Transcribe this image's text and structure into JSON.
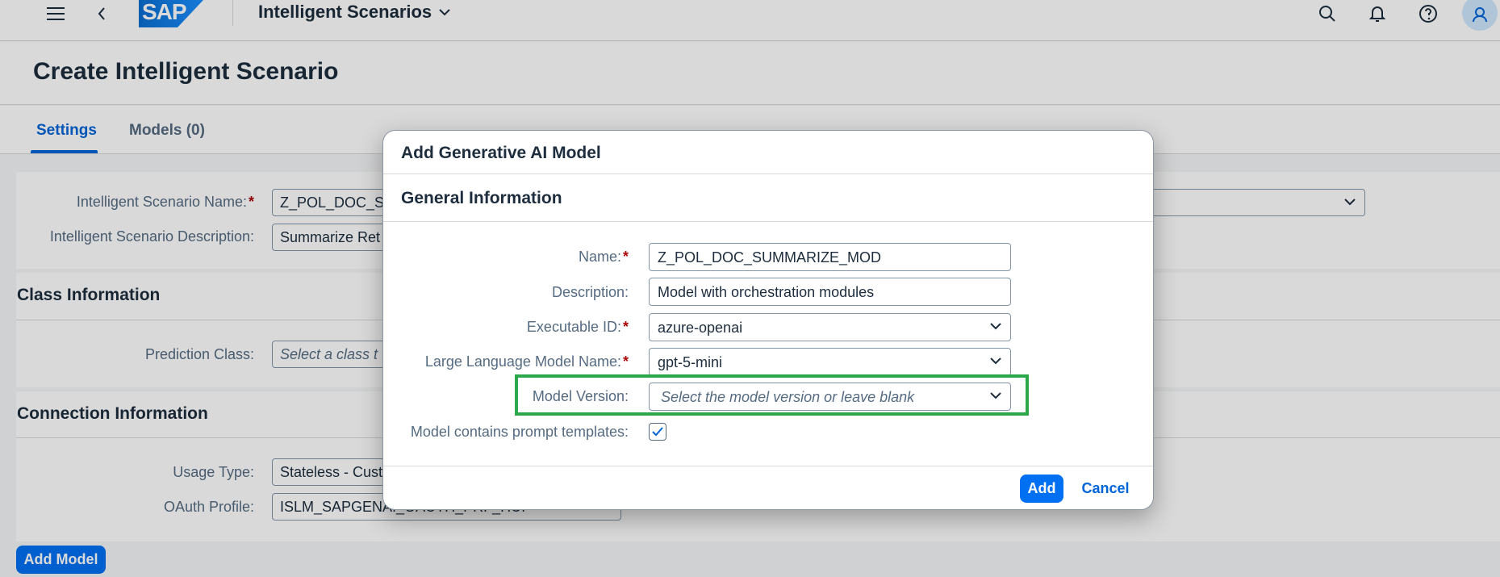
{
  "shell": {
    "logo_text": "SAP",
    "title": "Intelligent Scenarios"
  },
  "page": {
    "title": "Create Intelligent Scenario",
    "tabs": [
      {
        "label": "Settings"
      },
      {
        "label": "Models (0)"
      }
    ]
  },
  "settings": {
    "scenario_name_label": "Intelligent Scenario Name:",
    "scenario_name_value": "Z_POL_DOC_S",
    "scenario_desc_label": "Intelligent Scenario Description:",
    "scenario_desc_value": "Summarize Ret"
  },
  "class_info": {
    "title": "Class Information",
    "prediction_class_label": "Prediction Class:",
    "prediction_class_placeholder": "Select a class t"
  },
  "connection_info": {
    "title": "Connection Information",
    "usage_type_label": "Usage Type:",
    "usage_type_value": "Stateless - Cust",
    "oauth_label": "OAuth Profile:",
    "oauth_value": "ISLM_SAPGENAI_OAUTH_PRF_HUI"
  },
  "add_model_label": "Add Model",
  "dialog": {
    "title": "Add Generative AI Model",
    "section_title": "General Information",
    "fields": {
      "name_label": "Name:",
      "name_value": "Z_POL_DOC_SUMMARIZE_MOD",
      "description_label": "Description:",
      "description_value": "Model with orchestration modules",
      "executable_label": "Executable ID:",
      "executable_value": "azure-openai",
      "llm_label": "Large Language Model Name:",
      "llm_value": "gpt-5-mini",
      "version_label": "Model Version:",
      "version_placeholder": "Select the model version or leave blank",
      "prompt_templates_label": "Model contains prompt templates:",
      "prompt_templates_checked": true
    },
    "add_label": "Add",
    "cancel_label": "Cancel",
    "required_marker": "*"
  },
  "colors": {
    "brand": "#0070f2",
    "highlight": "#2aa84a",
    "required": "#aa0808"
  }
}
